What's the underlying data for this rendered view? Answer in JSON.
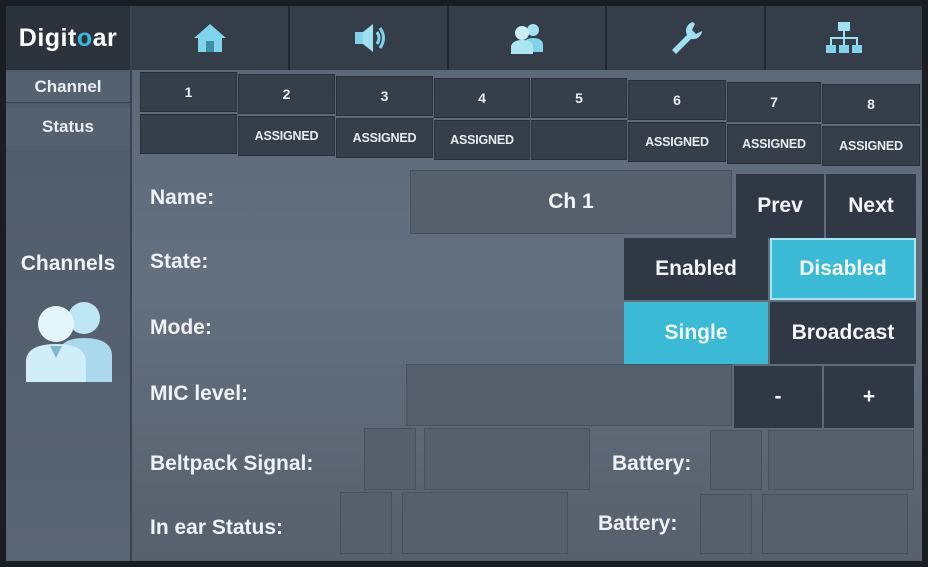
{
  "brand": {
    "logo_text_a": "Digit",
    "logo_text_b": "o",
    "logo_text_c": "ar"
  },
  "left": {
    "channel_label": "Channel",
    "status_label": "Status",
    "section_label": "Channels"
  },
  "tabs": [
    {
      "icon": "home-icon"
    },
    {
      "icon": "speaker-icon"
    },
    {
      "icon": "users-icon"
    },
    {
      "icon": "wrench-icon"
    },
    {
      "icon": "network-icon"
    }
  ],
  "channels": [
    {
      "number": "1",
      "status": ""
    },
    {
      "number": "2",
      "status": "ASSIGNED"
    },
    {
      "number": "3",
      "status": "ASSIGNED"
    },
    {
      "number": "4",
      "status": "ASSIGNED"
    },
    {
      "number": "5",
      "status": ""
    },
    {
      "number": "6",
      "status": "ASSIGNED"
    },
    {
      "number": "7",
      "status": "ASSIGNED"
    },
    {
      "number": "8",
      "status": "ASSIGNED"
    }
  ],
  "form": {
    "name_label": "Name:",
    "name_value": "Ch 1",
    "prev": "Prev",
    "next": "Next",
    "state_label": "State:",
    "enabled": "Enabled",
    "disabled": "Disabled",
    "selected_state": "Disabled",
    "mode_label": "Mode:",
    "single": "Single",
    "broadcast": "Broadcast",
    "selected_mode": "Single",
    "mic_label": "MIC level:",
    "mic_minus": "-",
    "mic_plus": "+",
    "beltpack_label": "Beltpack  Signal:",
    "battery_label_1": "Battery:",
    "inear_label": "In ear  Status:",
    "battery_label_2": "Battery:"
  },
  "colors": {
    "accent": "#3bbad6",
    "button": "#2f3844",
    "panel": "#5b6675"
  }
}
